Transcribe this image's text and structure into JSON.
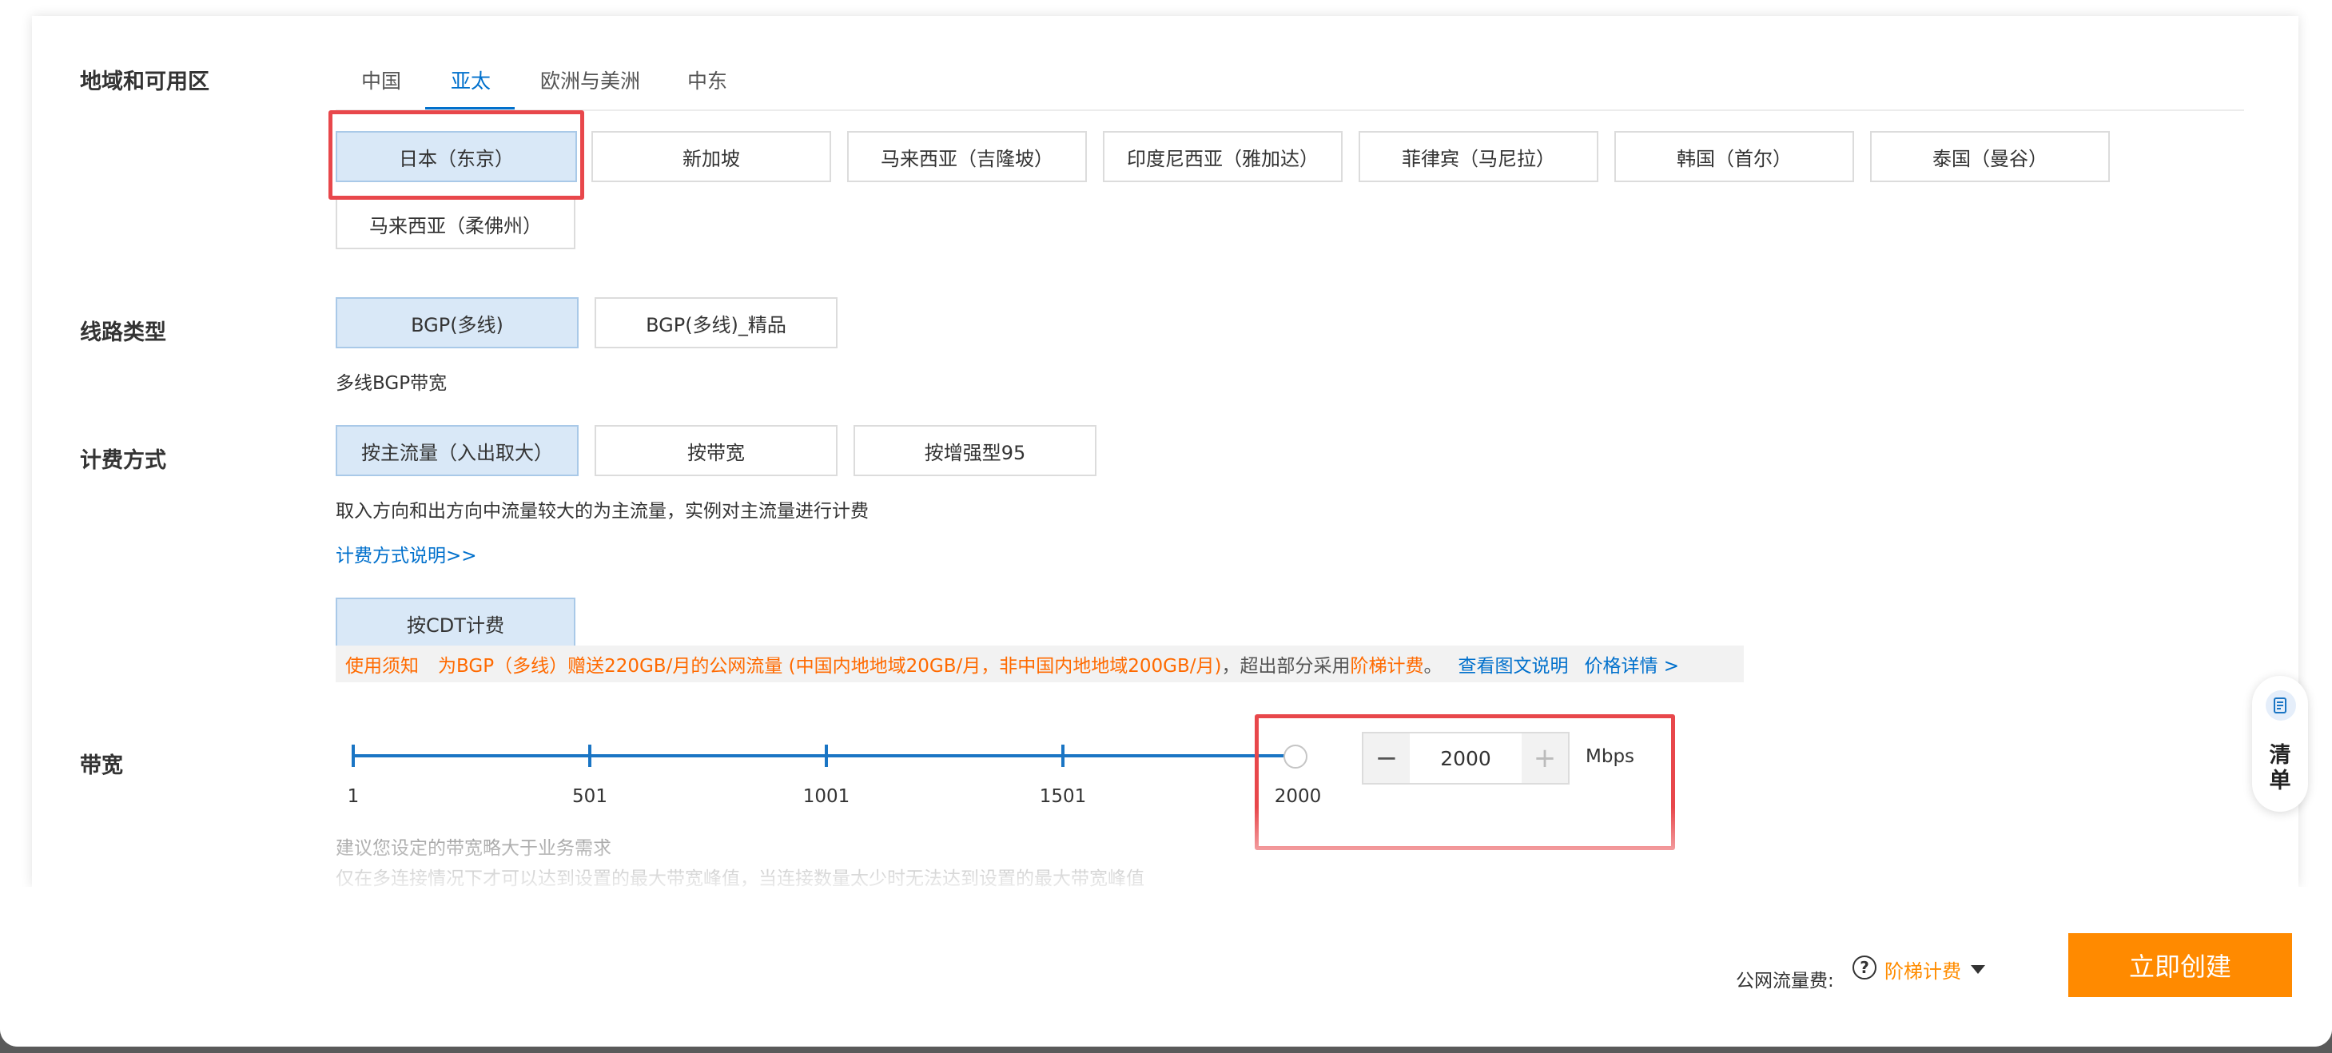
{
  "region": {
    "label": "地域和可用区",
    "tabs": [
      "中国",
      "亚太",
      "欧洲与美洲",
      "中东"
    ],
    "active_tab": "亚太",
    "options": [
      "日本（东京）",
      "新加坡",
      "马来西亚（吉隆坡）",
      "印度尼西亚（雅加达）",
      "菲律宾（马尼拉）",
      "韩国（首尔）",
      "泰国（曼谷）",
      "马来西亚（柔佛州）"
    ],
    "selected": "日本（东京）"
  },
  "line": {
    "label": "线路类型",
    "options": [
      "BGP(多线)",
      "BGP(多线)_精品"
    ],
    "selected": "BGP(多线)",
    "desc": "多线BGP带宽"
  },
  "billing": {
    "label": "计费方式",
    "options": [
      "按主流量（入出取大）",
      "按带宽",
      "按增强型95"
    ],
    "selected": "按主流量（入出取大）",
    "desc": "取入方向和出方向中流量较大的为主流量，实例对主流量进行计费",
    "link": "计费方式说明>>",
    "cdt_option": "按CDT计费",
    "notice": {
      "tag": "使用须知",
      "text": "为BGP（多线）赠送220GB/月的公网流量 (中国内地地域20GB/月，非中国内地地域200GB/月)",
      "text2": "，超出部分采用",
      "highlight": "阶梯计费",
      "text3": "。",
      "link1": "查看图文说明",
      "link2": "价格详情 >"
    }
  },
  "bandwidth": {
    "label": "带宽",
    "ticks": [
      "1",
      "501",
      "1001",
      "1501",
      "2000"
    ],
    "value": "2000",
    "min": 1,
    "max": 2000,
    "current": 2000,
    "unit": "Mbps",
    "minus": "−",
    "plus": "+",
    "hint1": "建议您设定的带宽略大于业务需求",
    "hint2": "仅在多连接情况下才可以达到设置的最大带宽峰值，当连接数量太少时无法达到设置的最大带宽峰值"
  },
  "footer": {
    "fee_label": "公网流量费:",
    "help": "?",
    "fee_value": "阶梯计费",
    "create": "立即创建"
  },
  "float": {
    "text": "清\n单"
  },
  "colors": {
    "primary": "#0070cc",
    "orange": "#ff8a00",
    "highlight_box": "#e8474b",
    "selected_bg": "#d9e8f7"
  }
}
